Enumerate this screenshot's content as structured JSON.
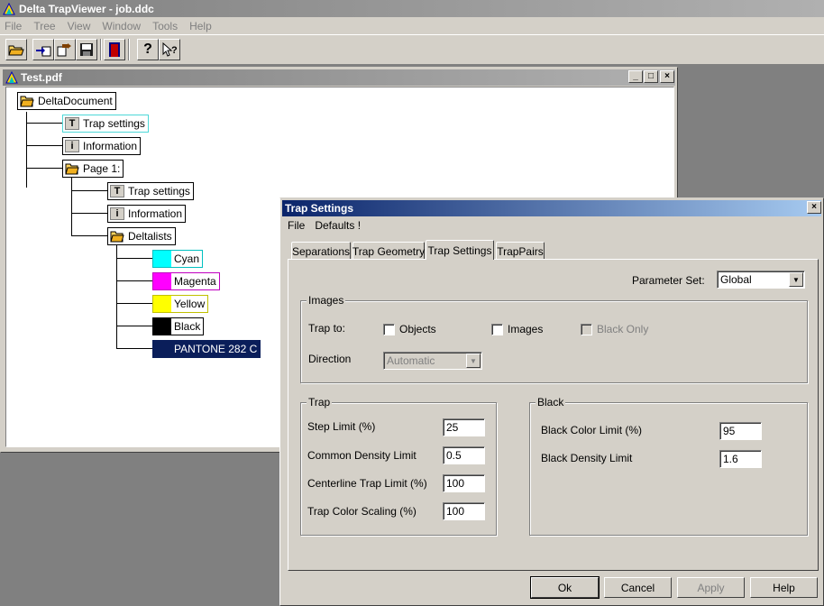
{
  "app": {
    "title": "Delta TrapViewer - job.ddc"
  },
  "menu": [
    "File",
    "Tree",
    "View",
    "Window",
    "Tools",
    "Help"
  ],
  "toolbar": {
    "buttons": [
      "open-folder-icon",
      "import-icon",
      "export-icon",
      "save-icon",
      "exit-door-icon",
      "help-icon",
      "context-help-icon"
    ]
  },
  "child_window": {
    "title": "Test.pdf",
    "tree": {
      "root": "DeltaDocument",
      "trap_settings": "Trap settings",
      "information": "Information",
      "page": "Page 1:",
      "page_trap_settings": "Trap settings",
      "page_information": "Information",
      "deltalists": "Deltalists",
      "colors": [
        {
          "label": "Cyan",
          "color": "#00ffff"
        },
        {
          "label": "Magenta",
          "color": "#ff00ff"
        },
        {
          "label": "Yellow",
          "color": "#ffff00"
        },
        {
          "label": "Black",
          "color": "#000000"
        },
        {
          "label": "PANTONE 282 C",
          "color": "#0a1e5a"
        }
      ]
    }
  },
  "dialog": {
    "title": "Trap Settings",
    "menu": [
      "File",
      "Defaults !"
    ],
    "tabs": [
      "Separations",
      "Trap Geometry",
      "Trap Settings",
      "TrapPairs"
    ],
    "active_tab": "Trap Settings",
    "parameter_set": {
      "label": "Parameter Set:",
      "value": "Global"
    },
    "images": {
      "group_label": "Images",
      "trap_to_label": "Trap to:",
      "objects_label": "Objects",
      "images_label": "Images",
      "black_only_label": "Black Only",
      "direction_label": "Direction",
      "direction_value": "Automatic"
    },
    "trap": {
      "group_label": "Trap",
      "step_limit_label": "Step Limit (%)",
      "step_limit_value": "25",
      "common_density_label": "Common Density Limit",
      "common_density_value": "0.5",
      "centerline_label": "Centerline Trap Limit (%)",
      "centerline_value": "100",
      "color_scaling_label": "Trap Color Scaling (%)",
      "color_scaling_value": "100"
    },
    "black": {
      "group_label": "Black",
      "color_limit_label": "Black Color Limit (%)",
      "color_limit_value": "95",
      "density_limit_label": "Black Density Limit",
      "density_limit_value": "1.6"
    },
    "buttons": {
      "ok": "Ok",
      "cancel": "Cancel",
      "apply": "Apply",
      "help": "Help"
    }
  }
}
